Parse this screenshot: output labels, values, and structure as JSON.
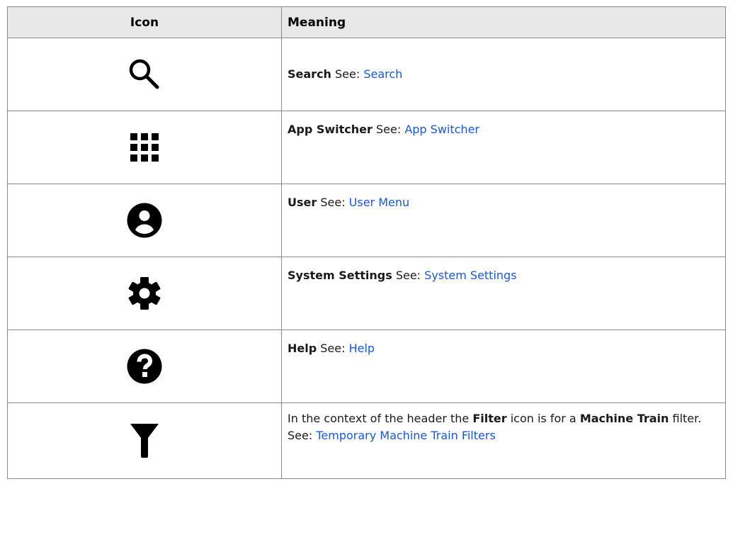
{
  "table": {
    "headers": {
      "icon": "Icon",
      "meaning": "Meaning"
    },
    "rows": [
      {
        "icon": "search-icon",
        "term": "Search",
        "see_label": " See: ",
        "link": "Search"
      },
      {
        "icon": "app-switcher-icon",
        "term": "App Switcher",
        "see_label": " See: ",
        "link": "App Switcher"
      },
      {
        "icon": "user-icon",
        "term": "User",
        "see_label": " See: ",
        "link": "User Menu"
      },
      {
        "icon": "gear-icon",
        "term": "System Settings",
        "see_label": " See: ",
        "link": "System Settings"
      },
      {
        "icon": "help-icon",
        "term": "Help",
        "see_label": " See: ",
        "link": "Help"
      },
      {
        "icon": "filter-icon",
        "text_1": "In the context of the header the ",
        "term_1": "Filter",
        "text_2": " icon is for a ",
        "term_2": "Machine Train",
        "text_3": " filter. See: ",
        "link": "Temporary Machine Train Filters"
      }
    ]
  },
  "colors": {
    "link": "#1a57e0",
    "header_background": "#e8e8e8",
    "border": "#8a8a8a"
  }
}
